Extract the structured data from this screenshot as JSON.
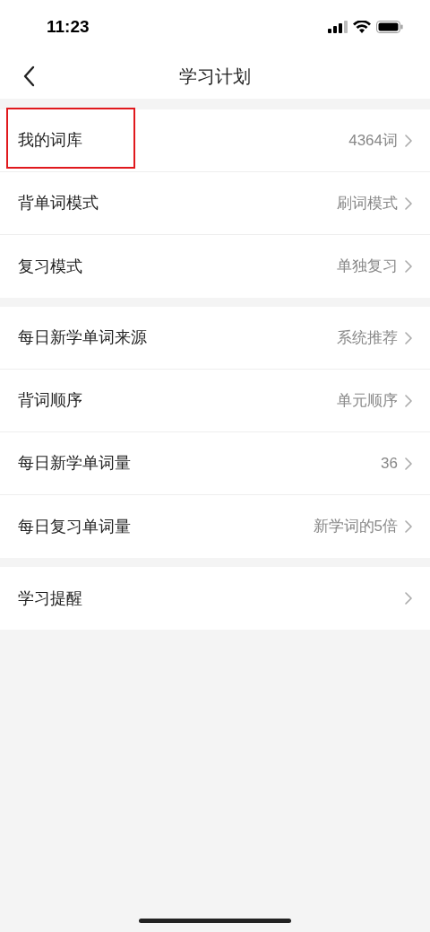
{
  "status_bar": {
    "time": "11:23"
  },
  "nav_bar": {
    "title": "学习计划"
  },
  "groups": [
    {
      "items": [
        {
          "label": "我的词库",
          "value": "4364词",
          "highlighted": true
        },
        {
          "label": "背单词模式",
          "value": "刷词模式",
          "highlighted": false
        },
        {
          "label": "复习模式",
          "value": "单独复习",
          "highlighted": false
        }
      ]
    },
    {
      "items": [
        {
          "label": "每日新学单词来源",
          "value": "系统推荐",
          "highlighted": false
        },
        {
          "label": "背词顺序",
          "value": "单元顺序",
          "highlighted": false
        },
        {
          "label": "每日新学单词量",
          "value": "36",
          "highlighted": false
        },
        {
          "label": "每日复习单词量",
          "value": "新学词的5倍",
          "highlighted": false
        }
      ]
    },
    {
      "items": [
        {
          "label": "学习提醒",
          "highlighted": false
        }
      ]
    }
  ]
}
